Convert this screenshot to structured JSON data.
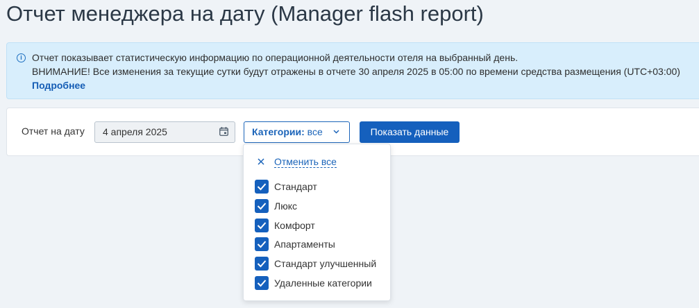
{
  "page": {
    "title": "Отчет менеджера на дату (Manager flash report)"
  },
  "info": {
    "icon": "info-icon",
    "line1": "Отчет показывает статистическую информацию по операционной деятельности отеля на выбранный день.",
    "line2": "ВНИМАНИЕ! Все изменения за текущие сутки будут отражены в отчете 30 апреля 2025 в 05:00 по времени средства размещения (UTC+03:00)",
    "more_link": "Подробнее"
  },
  "filters": {
    "date_label": "Отчет на дату",
    "date_value": "4 апреля 2025",
    "categories_label": "Категории:",
    "categories_value": "все",
    "show_button": "Показать данные"
  },
  "dropdown": {
    "cancel_all": "Отменить все",
    "items": [
      {
        "label": "Стандарт",
        "checked": true
      },
      {
        "label": "Люкс",
        "checked": true
      },
      {
        "label": "Комфорт",
        "checked": true
      },
      {
        "label": "Апартаменты",
        "checked": true
      },
      {
        "label": "Стандарт улучшенный",
        "checked": true
      },
      {
        "label": "Удаленные категории",
        "checked": true
      }
    ]
  },
  "colors": {
    "accent": "#1560bd",
    "info_bg": "#d8eefc",
    "page_bg": "#eff3f7"
  }
}
